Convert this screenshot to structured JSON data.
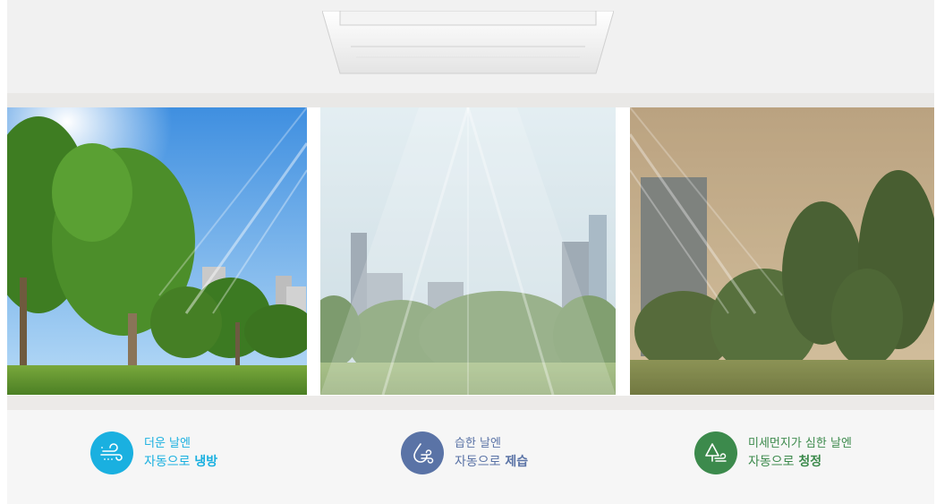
{
  "features": [
    {
      "name": "cooling",
      "line1": "더운 날엔",
      "line2_prefix": "자동으로",
      "line2_emph": "냉방",
      "color": "#1ab0e0",
      "icon": "wind-icon"
    },
    {
      "name": "dehumidify",
      "line1": "습한 날엔",
      "line2_prefix": "자동으로",
      "line2_emph": "제습",
      "color": "#5a73a6",
      "icon": "droplet-wind-icon"
    },
    {
      "name": "purify",
      "line1": "미세먼지가 심한 날엔",
      "line2_prefix": "자동으로",
      "line2_emph": "청정",
      "color": "#3c8a4c",
      "icon": "tree-wind-icon"
    }
  ]
}
